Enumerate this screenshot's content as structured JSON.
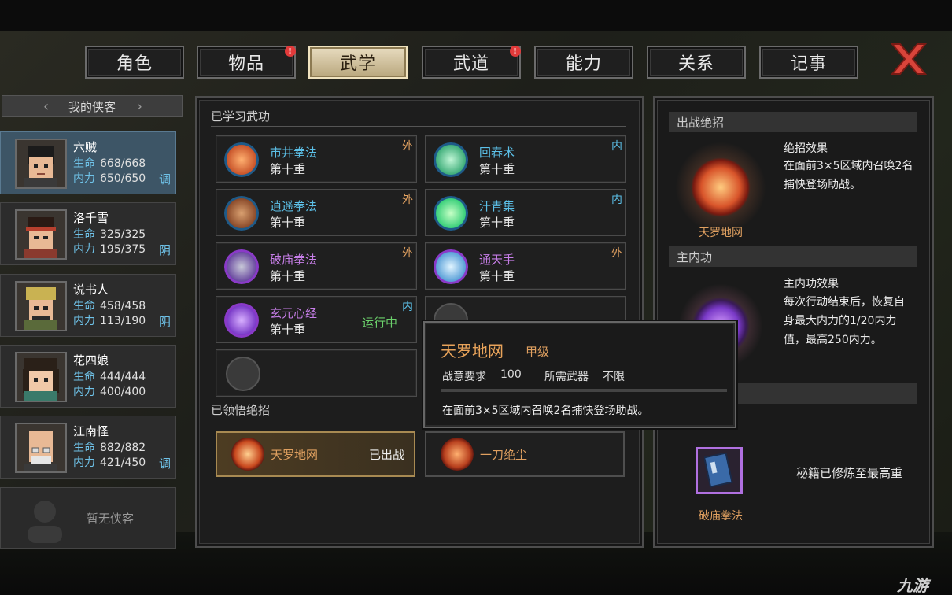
{
  "tabs": [
    {
      "label": "角色",
      "active": false,
      "badge": false
    },
    {
      "label": "物品",
      "active": false,
      "badge": true
    },
    {
      "label": "武学",
      "active": true,
      "badge": false
    },
    {
      "label": "武道",
      "active": false,
      "badge": true
    },
    {
      "label": "能力",
      "active": false,
      "badge": false
    },
    {
      "label": "关系",
      "active": false,
      "badge": false
    },
    {
      "label": "记事",
      "active": false,
      "badge": false
    }
  ],
  "badge_mark": "!",
  "roster": {
    "header": "我的侠客",
    "hp_label": "生命",
    "mp_label": "内力",
    "members": [
      {
        "name": "六贼",
        "hp": "668/668",
        "mp": "650/650",
        "yinyang": "调",
        "selected": true
      },
      {
        "name": "洛千雪",
        "hp": "325/325",
        "mp": "195/375",
        "yinyang": "阴",
        "selected": false
      },
      {
        "name": "说书人",
        "hp": "458/458",
        "mp": "113/190",
        "yinyang": "阴",
        "selected": false
      },
      {
        "name": "花四娘",
        "hp": "444/444",
        "mp": "400/400",
        "yinyang": "",
        "selected": false
      },
      {
        "name": "江南怪",
        "hp": "882/882",
        "mp": "421/450",
        "yinyang": "调",
        "selected": false
      }
    ],
    "empty_label": "暂无侠客"
  },
  "learned": {
    "title": "已学习武功",
    "skills": [
      {
        "name": "市井拳法",
        "level": "第十重",
        "type": "外",
        "color": "#5cc0e8"
      },
      {
        "name": "回春术",
        "level": "第十重",
        "type": "内",
        "color": "#5cc0e8"
      },
      {
        "name": "逍遥拳法",
        "level": "第十重",
        "type": "外",
        "color": "#5cc0e8"
      },
      {
        "name": "汗青集",
        "level": "第十重",
        "type": "内",
        "color": "#5cc0e8"
      },
      {
        "name": "破庙拳法",
        "level": "第十重",
        "type": "外",
        "color": "#c77ee8"
      },
      {
        "name": "通天手",
        "level": "第十重",
        "type": "外",
        "color": "#c77ee8"
      },
      {
        "name": "玄元心经",
        "level": "第十重",
        "type": "内",
        "color": "#c77ee8",
        "status": "运行中"
      }
    ]
  },
  "ultimates": {
    "title": "已领悟绝招",
    "items": [
      {
        "name": "天罗地网",
        "state": "已出战"
      },
      {
        "name": "一刀绝尘",
        "state": ""
      }
    ]
  },
  "right": {
    "ult_header": "出战绝招",
    "ult_effect_title": "绝招效果",
    "ult_effect_text": "在面前3×5区域内召唤2名捕快登场助战。",
    "ult_name": "天罗地网",
    "inner_header": "主内功",
    "inner_effect_title": "主内功效果",
    "inner_effect_text": "每次行动结束后，恢复自身最大内力的1/20内力值，最高250内力。",
    "book_status": "秘籍已修炼至最高重",
    "book_name": "破庙拳法"
  },
  "tooltip": {
    "name": "天罗地网",
    "grade": "甲级",
    "req_label": "战意要求",
    "req_value": "100",
    "weapon_label": "所需武器",
    "weapon_value": "不限",
    "desc": "在面前3×5区域内召唤2名捕快登场助战。"
  },
  "watermark": "九游"
}
